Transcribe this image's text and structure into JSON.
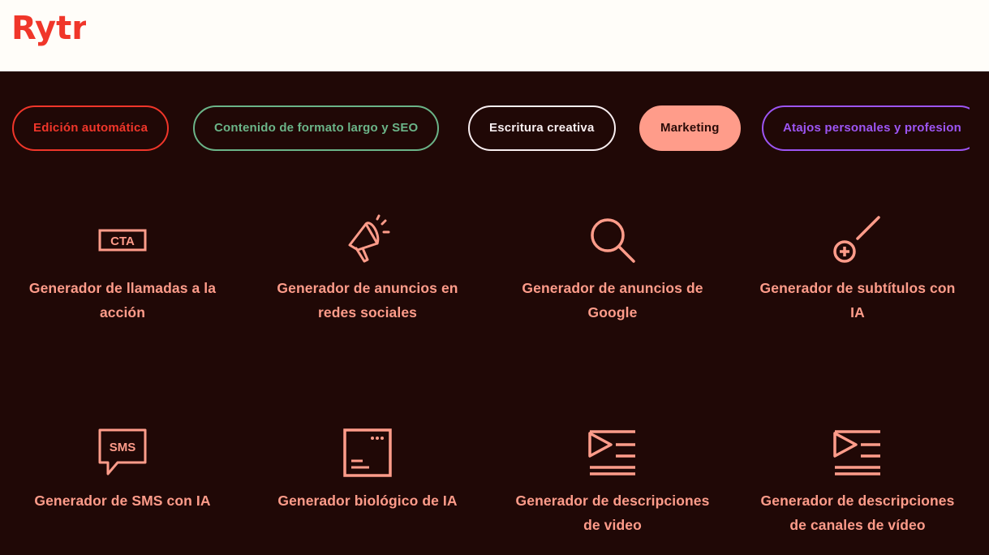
{
  "brand": {
    "logo_text": "Rytr",
    "color": "#f0362a"
  },
  "tabs": [
    {
      "label": "Edición automática",
      "color": "#f0362a"
    },
    {
      "label": "Contenido de formato largo y SEO",
      "color": "#6bb488"
    },
    {
      "label": "Escritura creativa",
      "color": "#f8eef0"
    },
    {
      "label": "Marketing",
      "color": "#ff9c8a",
      "selected": true
    },
    {
      "label": "Atajos personales y profesion",
      "color": "#9d55f3"
    }
  ],
  "tools": [
    {
      "icon": "cta-icon",
      "icon_text": "CTA",
      "label": "Generador de llamadas a la acción"
    },
    {
      "icon": "megaphone-icon",
      "label": "Generador de anuncios en redes sociales"
    },
    {
      "icon": "search-icon",
      "label": "Generador de anuncios de Google"
    },
    {
      "icon": "magic-wand-plus-icon",
      "label": "Generador de subtítulos con IA"
    },
    {
      "icon": "sms-bubble-icon",
      "icon_text": "SMS",
      "label": "Generador de SMS con IA"
    },
    {
      "icon": "bio-window-icon",
      "label": "Generador biológico de IA"
    },
    {
      "icon": "video-list-icon",
      "label": "Generador de descripciones de video"
    },
    {
      "icon": "video-list-icon",
      "label": "Generador de descripciones de canales de vídeo"
    }
  ],
  "colors": {
    "background": "#200806",
    "accent": "#ff9c8a",
    "header": "#fffdf9"
  }
}
